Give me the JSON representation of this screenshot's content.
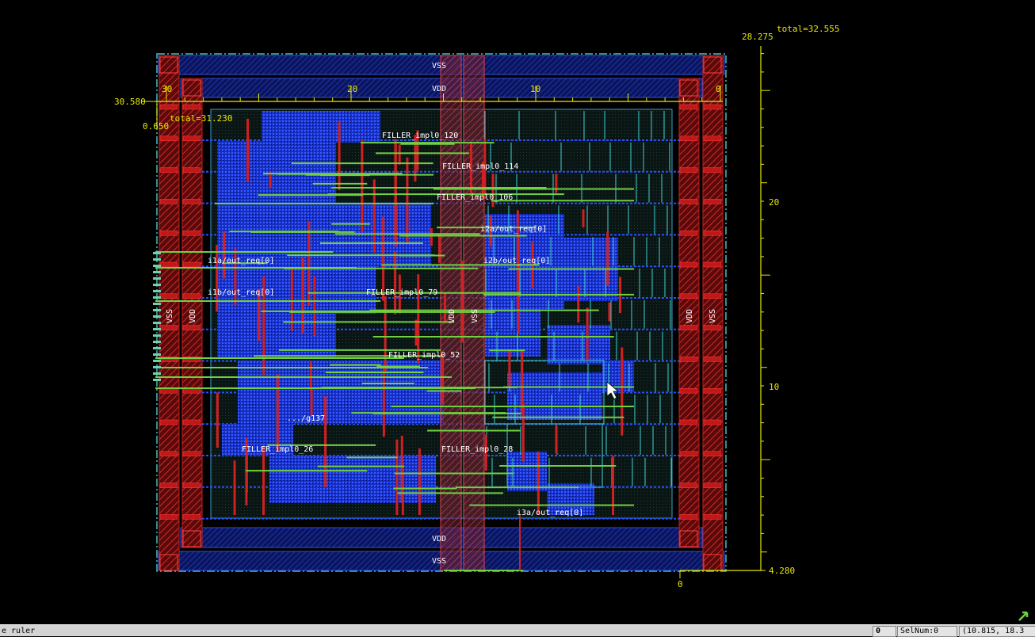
{
  "status_bar": {
    "left_text": "e ruler",
    "count_value": "0",
    "sel_num": "SelNum:0",
    "coords": "(10.815, 18.3"
  },
  "rulers": {
    "top_total": "total=32.555",
    "top_right_value": "28.275",
    "left_total": "total=31.230",
    "left_top_value": "30.580",
    "left_sub_value": "0.650",
    "bottom_right_value": "4.280",
    "bottom_zero": "0",
    "h_ticks": [
      "30",
      "20",
      "10",
      "0"
    ],
    "v_ticks": [
      "20",
      "10"
    ]
  },
  "rails": {
    "vss_top": "VSS",
    "vdd_top": "VDD",
    "vdd_bottom": "VDD",
    "vss_bottom": "VSS",
    "vss_left": "VSS",
    "vdd_left": "VDD",
    "vdd_center": "VDD",
    "vss_center": "VSS",
    "vdd_right": "VDD",
    "vss_right": "VSS"
  },
  "cell_labels": [
    "FILLER_impl0_120",
    "FILLER_impl0_114",
    "FILLER_impl0_106",
    "i2a/out_req[0]",
    "i1a/out_req[0]",
    "i1b/out_req[0]",
    "i2b/out_req[0]",
    "FILLER_impl0_79",
    "FILLER_impl0_52",
    ".../g137",
    "FILLER_impl0_26",
    "FILLER_impl0_28",
    "i3a/out_req[0]"
  ],
  "colors": {
    "background": "#000000",
    "ruler": "#e8e800",
    "frame": "#40c0c0",
    "power_rail": "#1a2a8a",
    "metal_blue": "#1f3cff",
    "metal_red": "#d02020",
    "metal_green": "#70d040",
    "cell_outline": "#40d0d0",
    "ring_red": "#b01818"
  }
}
